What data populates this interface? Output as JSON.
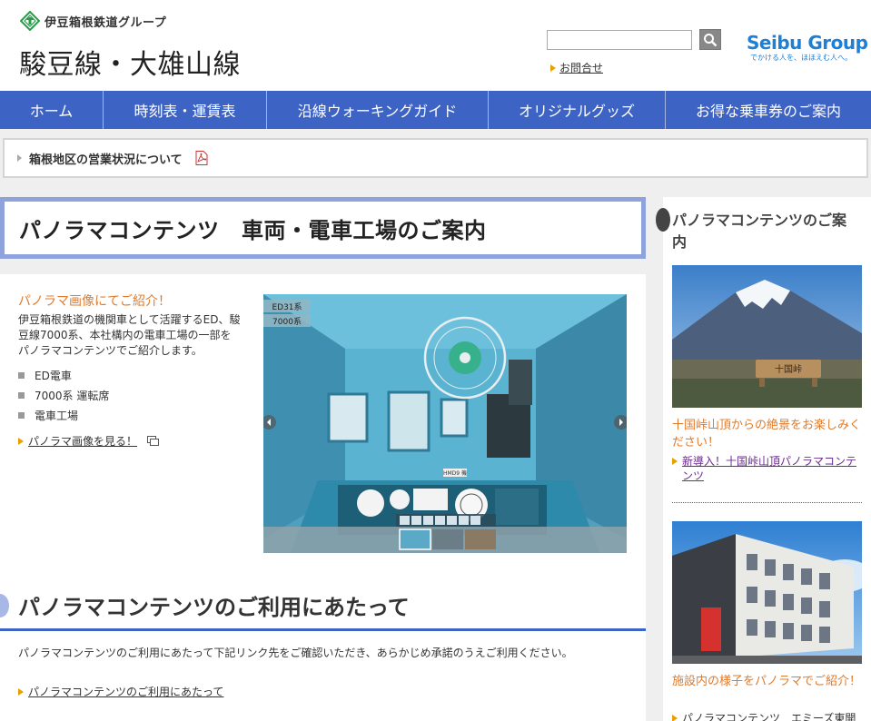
{
  "header": {
    "group_name": "伊豆箱根鉄道グループ",
    "line_title": "駿豆線・大雄山線",
    "search_placeholder": "",
    "contact_label": "お問合せ",
    "seibu_name": "Seibu Group",
    "seibu_tagline": "でかける人を、ほほえむ人へ。"
  },
  "nav": {
    "items": [
      "ホーム",
      "時刻表・運賃表",
      "沿線ウォーキングガイド",
      "オリジナルグッズ",
      "お得な乗車券のご案内"
    ]
  },
  "notice": {
    "label": "箱根地区の営業状況について"
  },
  "main": {
    "page_title": "パノラマコンテンツ　車両・電車工場のご案内",
    "panorama_heading": "パノラマ画像にてご紹介！",
    "panorama_desc": "伊豆箱根鉄道の機関車として活躍するED、駿豆線7000系、本社構内の電車工場の一部をパノラマコンテンツでご紹介します。",
    "list": [
      "ED電車",
      "7000系 運転席",
      "電車工場"
    ],
    "see_link": "パノラマ画像を見る！",
    "pano_tags": [
      "ED31系",
      "7000系"
    ],
    "pano_badge": "HMD9 機",
    "usage_heading": "パノラマコンテンツのご利用にあたって",
    "usage_text": "パノラマコンテンツのご利用にあたって下記リンク先をご確認いただき、あらかじめ承諾のうえご利用ください。",
    "usage_link": "パノラマコンテンツのご利用にあたって"
  },
  "sidebar": {
    "title": "パノラマコンテンツのご案内",
    "sign_text": "十国峠",
    "caption1": "十国峠山頂からの絶景をお楽しみください！",
    "link1": "新導入！十国峠山頂パノラマコンテンツ",
    "caption2": "施設内の様子をパノラマでご紹介！",
    "link2": "パノラマコンテンツ　エミーズ東開"
  },
  "colors": {
    "nav_bg": "#3d63c4",
    "accent_orange": "#e07b2c",
    "title_border": "#8ea2dc"
  }
}
